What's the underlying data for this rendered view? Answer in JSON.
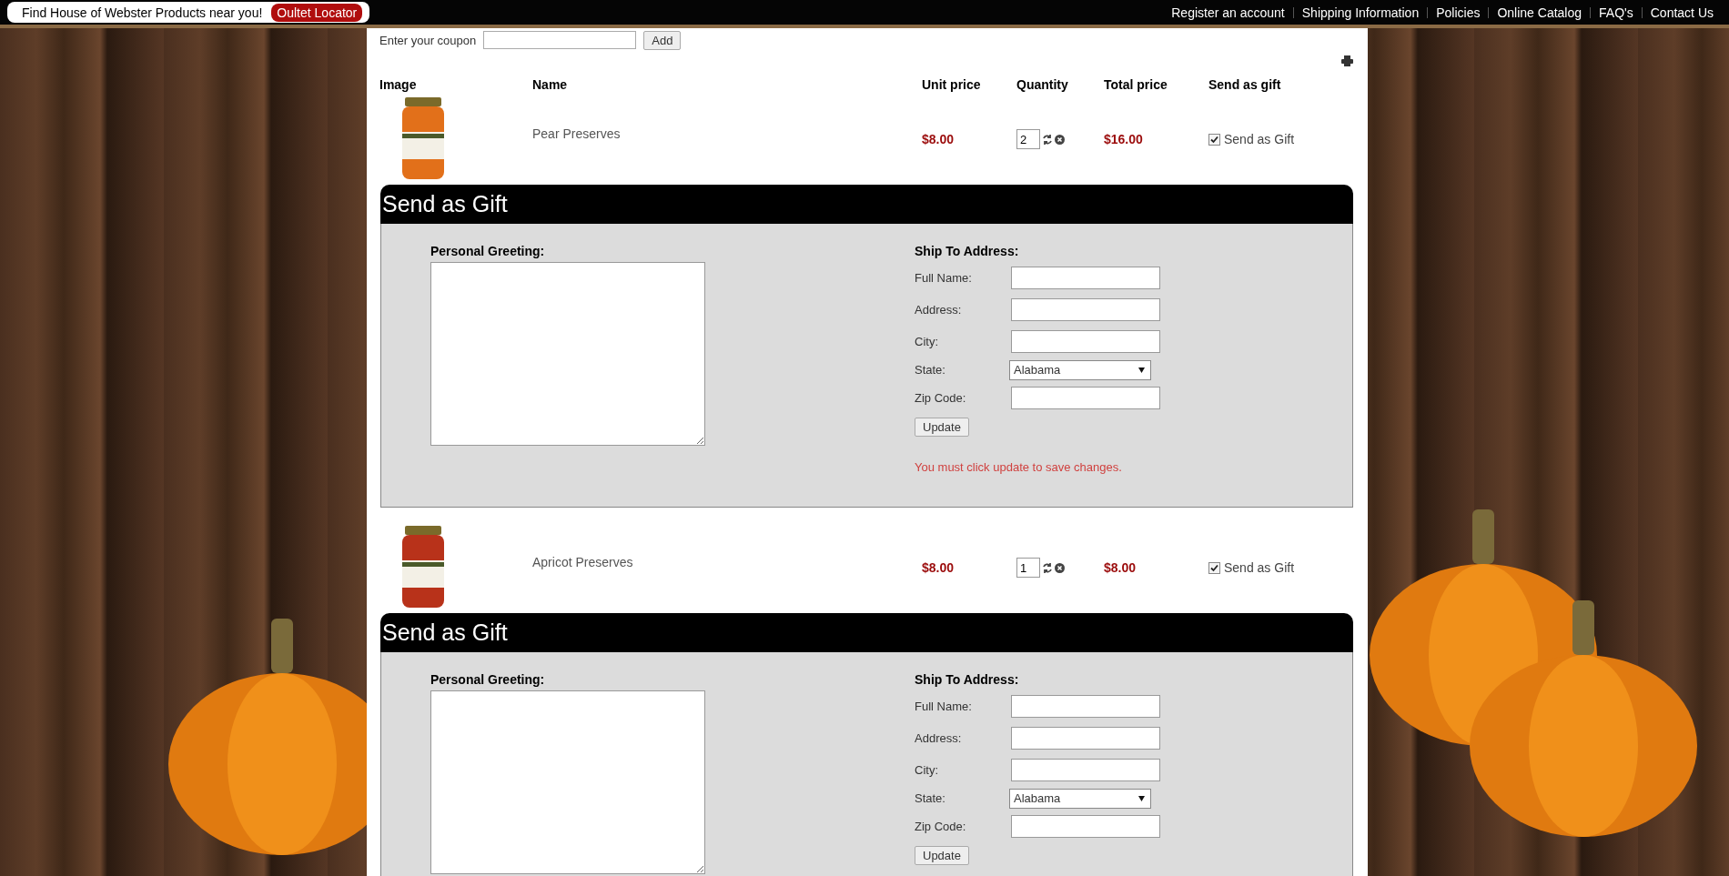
{
  "top_bar": {
    "promo": "Find House of Webster Products near you!",
    "locator_button": "Oultet Locator",
    "links": [
      "Register an account",
      "Shipping Information",
      "Policies",
      "Online Catalog",
      "FAQ's",
      "Contact Us"
    ]
  },
  "coupon": {
    "label": "Enter your coupon",
    "button": "Add"
  },
  "cart": {
    "columns": [
      "Image",
      "Name",
      "Unit price",
      "Quantity",
      "Total price",
      "Send as gift"
    ],
    "items": [
      {
        "name": "Pear Preserves",
        "unit_price": "$8.00",
        "quantity": "2",
        "total_price": "$16.00",
        "send_as_gift": true,
        "gift_label": "Send as Gift",
        "gift_panel": {
          "title": "Send as Gift",
          "greeting_label": "Personal Greeting:",
          "address_title": "Ship To Address:",
          "fields": [
            {
              "label": "Full Name:",
              "kind": "text"
            },
            {
              "label": "Address:",
              "kind": "text"
            },
            {
              "label": "City:",
              "kind": "text"
            },
            {
              "label": "State:",
              "kind": "select",
              "value": "Alabama"
            },
            {
              "label": "Zip Code:",
              "kind": "text"
            }
          ],
          "update_button": "Update",
          "notice": "You must click update to save changes."
        }
      },
      {
        "name": "Apricot Preserves",
        "unit_price": "$8.00",
        "quantity": "1",
        "total_price": "$8.00",
        "send_as_gift": true,
        "gift_label": "Send as Gift",
        "gift_panel": {
          "title": "Send as Gift",
          "greeting_label": "Personal Greeting:",
          "address_title": "Ship To Address:",
          "fields": [
            {
              "label": "Full Name:",
              "kind": "text"
            },
            {
              "label": "Address:",
              "kind": "text"
            },
            {
              "label": "City:",
              "kind": "text"
            },
            {
              "label": "State:",
              "kind": "select",
              "value": "Alabama"
            },
            {
              "label": "Zip Code:",
              "kind": "text"
            }
          ],
          "update_button": "Update"
        }
      }
    ]
  }
}
